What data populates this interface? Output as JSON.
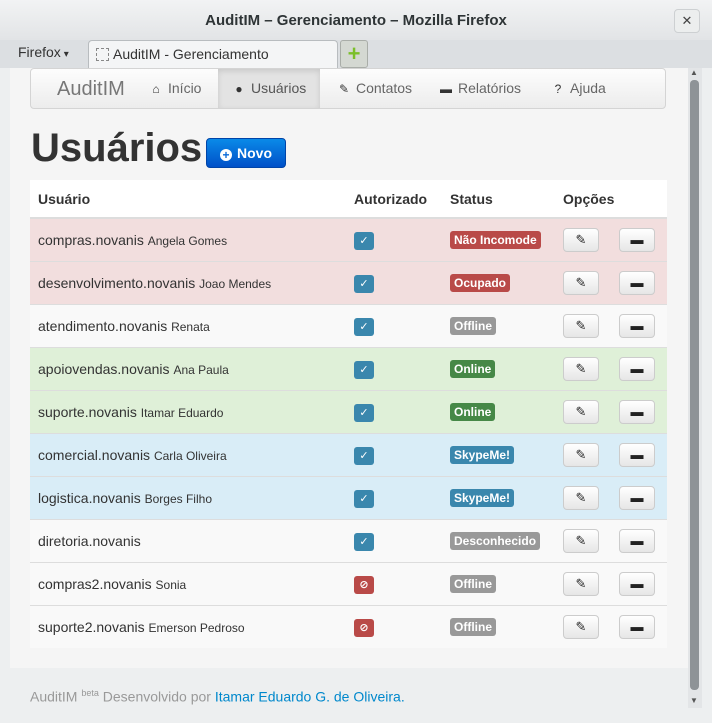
{
  "window": {
    "title": "AuditIM – Gerenciamento – Mozilla Firefox",
    "close_glyph": "✕"
  },
  "browser": {
    "menu_label": "Firefox",
    "tab_title": "AuditIM - Gerenciamento",
    "new_tab_glyph": "+"
  },
  "nav": {
    "brand": "AuditIM",
    "items": [
      {
        "label": "Início",
        "icon": "home-icon"
      },
      {
        "label": "Usuários",
        "icon": "user-icon"
      },
      {
        "label": "Contatos",
        "icon": "edit-icon"
      },
      {
        "label": "Relatórios",
        "icon": "comment-icon"
      },
      {
        "label": "Ajuda",
        "icon": "question-icon"
      }
    ],
    "active_item": "Usuários"
  },
  "page": {
    "title": "Usuários",
    "new_button": "Novo"
  },
  "table": {
    "headers": {
      "user": "Usuário",
      "authorized": "Autorizado",
      "status": "Status",
      "options": "Opções"
    },
    "rows": [
      {
        "login": "compras.novanis",
        "name": "Angela Gomes",
        "authorized": true,
        "status": "Não Incomode"
      },
      {
        "login": "desenvolvimento.novanis",
        "name": "Joao Mendes",
        "authorized": true,
        "status": "Ocupado"
      },
      {
        "login": "atendimento.novanis",
        "name": "Renata",
        "authorized": true,
        "status": "Offline"
      },
      {
        "login": "apoiovendas.novanis",
        "name": "Ana Paula",
        "authorized": true,
        "status": "Online"
      },
      {
        "login": "suporte.novanis",
        "name": "Itamar Eduardo",
        "authorized": true,
        "status": "Online"
      },
      {
        "login": "comercial.novanis",
        "name": "Carla Oliveira",
        "authorized": true,
        "status": "SkypeMe!"
      },
      {
        "login": "logistica.novanis",
        "name": "Borges Filho",
        "authorized": true,
        "status": "SkypeMe!"
      },
      {
        "login": "diretoria.novanis",
        "name": "",
        "authorized": true,
        "status": "Desconhecido"
      },
      {
        "login": "compras2.novanis",
        "name": "Sonia",
        "authorized": false,
        "status": "Offline"
      },
      {
        "login": "suporte2.novanis",
        "name": "Emerson Pedroso",
        "authorized": false,
        "status": "Offline"
      }
    ]
  },
  "footer": {
    "brand": "AuditIM",
    "badge": "beta",
    "text": "Desenvolvido por",
    "author": "Itamar Eduardo G. de Oliveira."
  },
  "colors": {
    "primary_button": "#0a6ad8",
    "status_busy": "#b94a48",
    "status_online": "#468847",
    "status_skypeme": "#3a87ad",
    "status_offline": "#999999",
    "row_busy_bg": "#f2dede",
    "row_online_bg": "#dff0d8",
    "row_skypeme_bg": "#d9edf7",
    "link": "#0088cc"
  }
}
